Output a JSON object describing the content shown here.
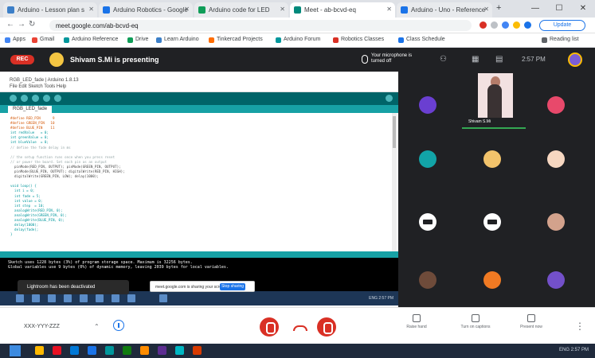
{
  "browser": {
    "tabs": [
      {
        "label": "Arduino - Lesson plan s",
        "color": "#3c7fc8"
      },
      {
        "label": "Arduino Robotics - Google",
        "color": "#1a73e8"
      },
      {
        "label": "Arduino code for LED",
        "color": "#0f9d58"
      },
      {
        "label": "Meet - ab-bcvd-eq",
        "color": "#00897b"
      },
      {
        "label": "Arduino - Uno - Reference",
        "color": "#1a73e8"
      }
    ],
    "url": "meet.google.com/ab-bcvd-eq",
    "resume_label": "Update",
    "bookmarks": [
      {
        "label": "Apps",
        "color": "#4285f4"
      },
      {
        "label": "Gmail",
        "color": "#ea4335"
      },
      {
        "label": "Arduino Reference",
        "color": "#00979c"
      },
      {
        "label": "Drive",
        "color": "#0f9d58"
      },
      {
        "label": "Learn Arduino",
        "color": "#3c7fc8"
      },
      {
        "label": "Tinkercad Projects",
        "color": "#ff6d00"
      },
      {
        "label": "Arduino Forum",
        "color": "#00979c"
      },
      {
        "label": "Robotics Classes",
        "color": "#d93025"
      },
      {
        "label": "Class Schedule",
        "color": "#1a73e8"
      },
      {
        "label": "Reading list",
        "color": "#5f6368"
      }
    ]
  },
  "meet_top": {
    "live": "REC",
    "presenting": "Shivam S.Mi is presenting",
    "mic_notice": "Your microphone is turned off",
    "clock": "2:57 PM"
  },
  "ide": {
    "title": "RGB_LED_fade | Arduino 1.8.13",
    "menu": "File  Edit  Sketch  Tools  Help",
    "tab": "RGB_LED_fade",
    "code_lines": [
      {
        "cls": "kw",
        "text": "#define RED_PIN      9"
      },
      {
        "cls": "kw",
        "text": "#define GREEN_PIN   10"
      },
      {
        "cls": "kw",
        "text": "#define BLUE_PIN    11"
      },
      {
        "cls": "ty",
        "text": "int redValue   = 0;"
      },
      {
        "cls": "ty",
        "text": "int greenValue = 0;"
      },
      {
        "cls": "ty",
        "text": "int blueValue  = 0;"
      },
      {
        "cls": "cm",
        "text": "// define the fade delay in ms"
      },
      {
        "cls": "",
        "text": ""
      },
      {
        "cls": "cm",
        "text": "// the setup function runs once when you press reset"
      },
      {
        "cls": "cm",
        "text": "// or power the board. Set each pin as an output"
      },
      {
        "cls": "",
        "text": "  pinMode(RED_PIN, OUTPUT); pinMode(GREEN_PIN, OUTPUT);"
      },
      {
        "cls": "",
        "text": "  pinMode(BLUE_PIN, OUTPUT); digitalWrite(RED_PIN, HIGH);"
      },
      {
        "cls": "",
        "text": "  digitalWrite(GREEN_PIN, LOW); delay(1000);"
      },
      {
        "cls": "",
        "text": ""
      },
      {
        "cls": "ty",
        "text": "void loop() {"
      },
      {
        "cls": "ty",
        "text": "  int i = 0;"
      },
      {
        "cls": "ty",
        "text": "  int fade = 5;"
      },
      {
        "cls": "ty",
        "text": "  int value = 0;"
      },
      {
        "cls": "ty",
        "text": "  int step  = 10;"
      },
      {
        "cls": "ty",
        "text": "  analogWrite(RED_PIN, 0);"
      },
      {
        "cls": "ty",
        "text": "  analogWrite(GREEN_PIN, 0);"
      },
      {
        "cls": "ty",
        "text": "  analogWrite(BLUE_PIN, 0);"
      },
      {
        "cls": "ty",
        "text": "  delay(1000);"
      },
      {
        "cls": "ty",
        "text": "  delay(fade);"
      },
      {
        "cls": "ty",
        "text": "}"
      }
    ],
    "console": [
      "Sketch uses 1228 bytes (3%) of program storage space. Maximum is 32256 bytes.",
      "Global variables use 9 bytes (0%) of dynamic memory, leaving 2039 bytes for local variables."
    ]
  },
  "overlays": {
    "undo": "Lightroom has been deactivated",
    "sharing": "meet.google.com is sharing your screen.",
    "stop": "Stop sharing",
    "tray": "ENG  2:57 PM"
  },
  "grid": {
    "video_label": "Shivam S.Mi",
    "avatars": [
      {
        "name": "participant-v",
        "color": "#6a3fd1",
        "letter": "V"
      },
      {
        "name": "participant-b",
        "color": "#e8496b",
        "letter": ""
      },
      {
        "name": "participant-c",
        "color": "#12a4a7",
        "letter": ""
      },
      {
        "name": "participant-girl",
        "color": "#f2c36b",
        "letter": ""
      },
      {
        "name": "participant-boy",
        "color": "#f6d7c1",
        "letter": ""
      },
      {
        "name": "participant-face",
        "color": "#d3a28c",
        "letter": ""
      },
      {
        "name": "participant-r",
        "color": "#6e4b3a",
        "letter": "R"
      },
      {
        "name": "participant-p",
        "color": "#f07a23",
        "letter": "P"
      },
      {
        "name": "participant-s",
        "color": "#7350c9",
        "letter": "S"
      }
    ]
  },
  "meet_bottom": {
    "meeting_code": "XXX-YYY-ZZZ",
    "tools": [
      "Raise hand",
      "Turn on captions",
      "Present now"
    ]
  },
  "taskbar": {
    "apps": [
      "#ffb900",
      "#e81123",
      "#0078d7",
      "#1a73e8",
      "#00979c",
      "#107c10",
      "#ff8c00",
      "#5c2d91",
      "#00b7c3",
      "#d83b01"
    ],
    "tray": "ENG  2:57 PM"
  }
}
